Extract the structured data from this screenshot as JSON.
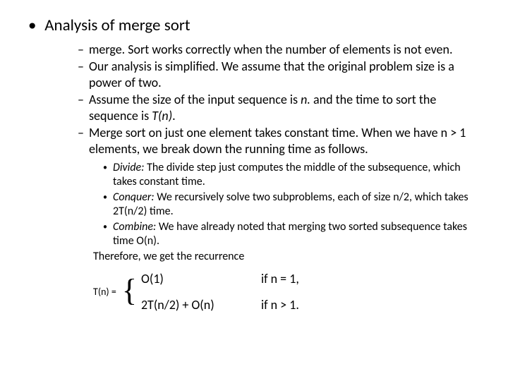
{
  "lvl1": {
    "title": "Analysis of merge sort"
  },
  "lvl2": {
    "items": [
      {
        "pre": "merge. Sort ",
        "post": "works correctly when the number of elements is not even."
      },
      {
        "text": "Our analysis is simplified. We assume that the original problem size is a power of two."
      },
      {
        "pre": "Assume the size of the input sequence is ",
        "it1": "n.",
        "mid": " and the time to sort the sequence is ",
        "it2": "T(n)",
        "post": "."
      },
      {
        "text": "Merge sort on just one element takes constant time. When we have n > 1 elements, we break down the running time as follows."
      }
    ]
  },
  "lvl3": {
    "items": [
      {
        "head": "Divide:",
        "body": " The divide step just computes the middle of the subsequence, which takes constant time."
      },
      {
        "head": "Conquer:",
        "body": " We recursively solve two subproblems, each of size n/2, which takes 2T(n/2) time."
      },
      {
        "head": "Combine:",
        "body": " We have already noted that merging two sorted subsequence takes time O(n)."
      }
    ],
    "therefore": "Therefore, we get the recurrence"
  },
  "recurrence": {
    "lhs": "T(n) =",
    "case1_expr": "O(1)",
    "case1_cond": "if n = 1,",
    "case2_expr": "2T(n/2) + O(n)",
    "case2_cond": "if n > 1."
  }
}
